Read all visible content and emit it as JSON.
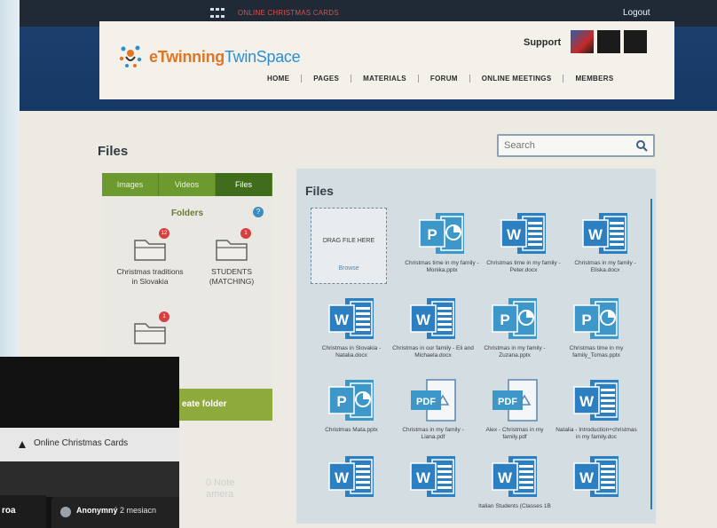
{
  "topbar": {
    "title": "ONLINE CHRISTMAS CARDS",
    "logout": "Logout"
  },
  "header": {
    "logo_prefix": "eTwinning",
    "logo_suffix": "TwinSpace",
    "support": "Support",
    "nav": [
      "HOME",
      "PAGES",
      "MATERIALS",
      "FORUM",
      "ONLINE MEETINGS",
      "MEMBERS"
    ]
  },
  "page": {
    "title": "Files"
  },
  "search": {
    "placeholder": "Search"
  },
  "left_panel": {
    "tabs": [
      "Images",
      "Videos",
      "Files"
    ],
    "active_tab": "Files",
    "folders_label": "Folders",
    "folders": [
      {
        "label": "Christmas traditions in Slovakia",
        "badge": "12"
      },
      {
        "label": "STUDENTS (MATCHING)",
        "badge": "1"
      },
      {
        "label": "",
        "badge": "1"
      }
    ],
    "create_folder": "eate folder"
  },
  "files_panel": {
    "title": "Files",
    "drag_text": "DRAG FILE HERE",
    "browse": "Browse",
    "files": [
      {
        "type": "pptx",
        "name": "Christmas time in my family - Monika.pptx"
      },
      {
        "type": "docx",
        "name": "Christmas time in my family - Peter.docx"
      },
      {
        "type": "docx",
        "name": "Christmas in my family - Eliska.docx"
      },
      {
        "type": "docx",
        "name": "Christmas in Slovakia - Natalia.docx"
      },
      {
        "type": "docx",
        "name": "Christmas in our family - Eli and Michaela.docx"
      },
      {
        "type": "pptx",
        "name": "Christmas in my family - Zuzana.pptx"
      },
      {
        "type": "pptx",
        "name": "Christmas time in my family_Tomas.pptx"
      },
      {
        "type": "pptx",
        "name": "Christmas Mata.pptx"
      },
      {
        "type": "pdf",
        "name": "Christmas in my family - Liana.pdf"
      },
      {
        "type": "pdf",
        "name": "Alex - Christmas in my family.pdf"
      },
      {
        "type": "docx",
        "name": "Natalia - Introduction+christmas in my family.doc"
      },
      {
        "type": "docx",
        "name": ""
      },
      {
        "type": "docx",
        "name": ""
      },
      {
        "type": "docx",
        "name": "Italian Students (Classes 1B"
      },
      {
        "type": "docx",
        "name": ""
      }
    ]
  },
  "phone": {
    "tab_label": "Online Christmas Cards",
    "prefix": "roa",
    "card_user": "Anonymný",
    "card_time": "2 mesiacn",
    "watermark_line1": "0 Note",
    "watermark_line2": "amera"
  },
  "colors": {
    "topbar": "#1f2a36",
    "brand_orange": "#e07524",
    "brand_blue": "#2d8fcf",
    "tabs_green": "#6c9a2f",
    "word_blue": "#2c7fc0",
    "ppt_blue": "#3d97c8",
    "badge_red": "#d64040"
  },
  "icons": {
    "grid": "grid-icon",
    "search": "search-icon",
    "help": "help-icon",
    "folder": "folder-icon",
    "word": "word-file-icon",
    "powerpoint": "powerpoint-file-icon",
    "pdf": "pdf-file-icon"
  }
}
